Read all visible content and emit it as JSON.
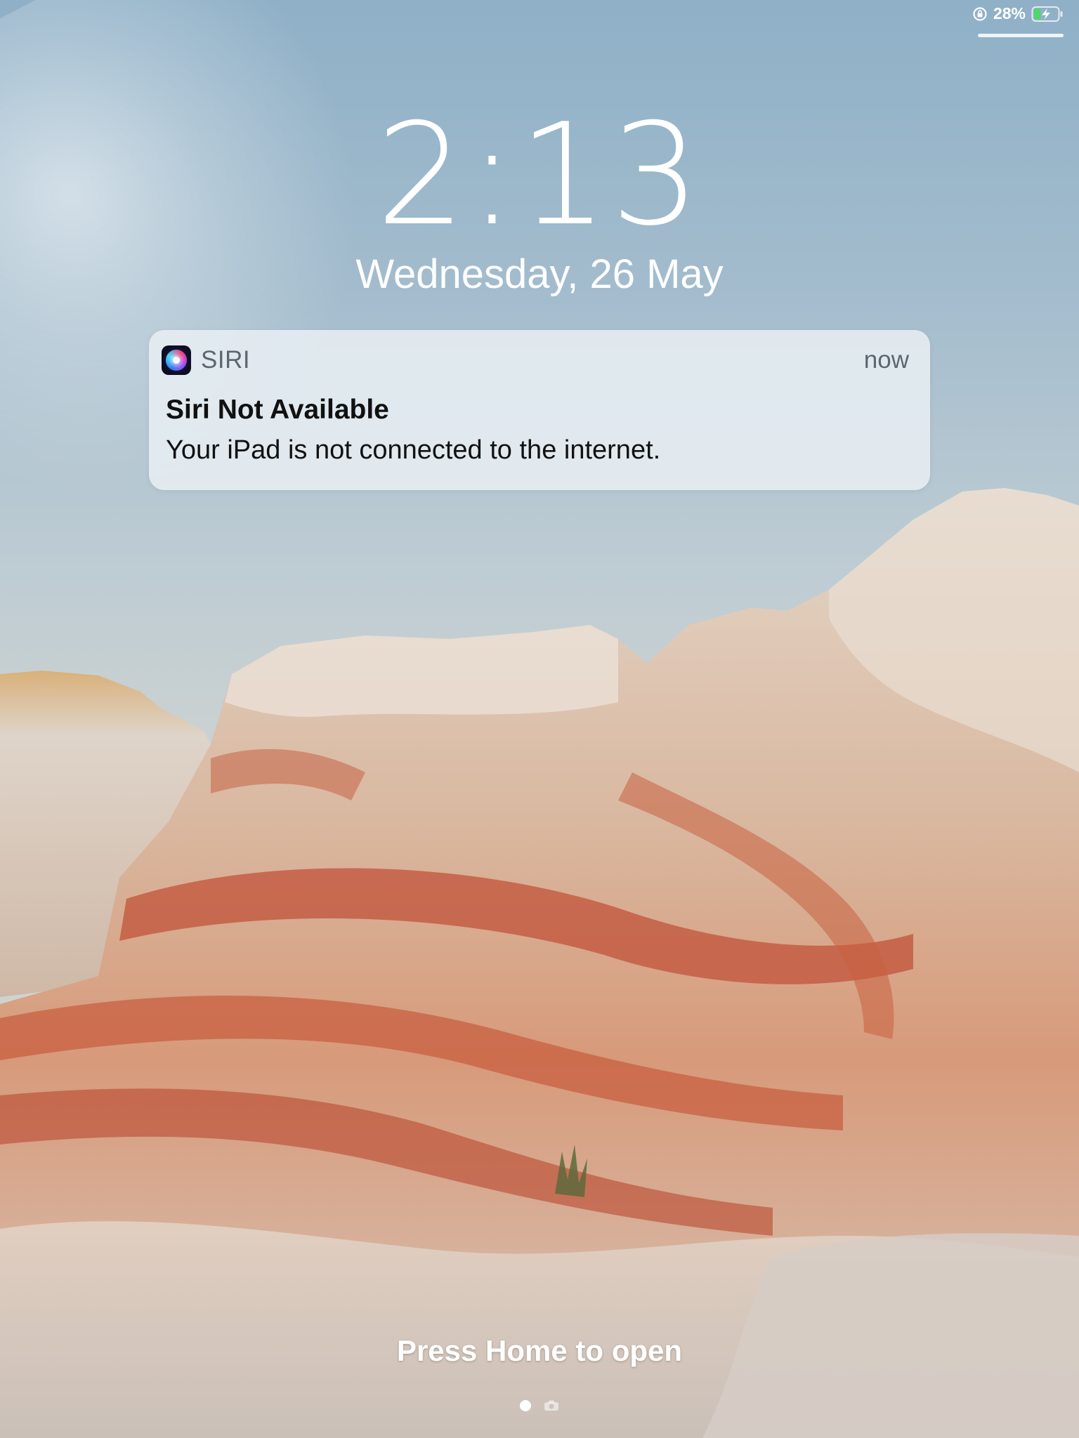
{
  "status_bar": {
    "battery_percent": "28%",
    "battery_level": 0.28,
    "charging": true,
    "icons": [
      "orientation-lock-icon",
      "battery-charging-icon"
    ]
  },
  "lock_screen": {
    "time": "2:13",
    "date": "Wednesday, 26 May",
    "unlock_hint": "Press Home to open"
  },
  "notification": {
    "app_name": "SIRI",
    "app_icon": "siri-icon",
    "time": "now",
    "title": "Siri Not Available",
    "body": "Your iPad is not connected to the internet."
  },
  "page_indicator": {
    "pages": [
      "lock-screen",
      "camera"
    ],
    "current": 0
  },
  "colors": {
    "text_primary": "#ffffff",
    "notification_bg": "#e7eef3",
    "notification_text": "#111111",
    "notification_secondary": "#5c6670"
  }
}
